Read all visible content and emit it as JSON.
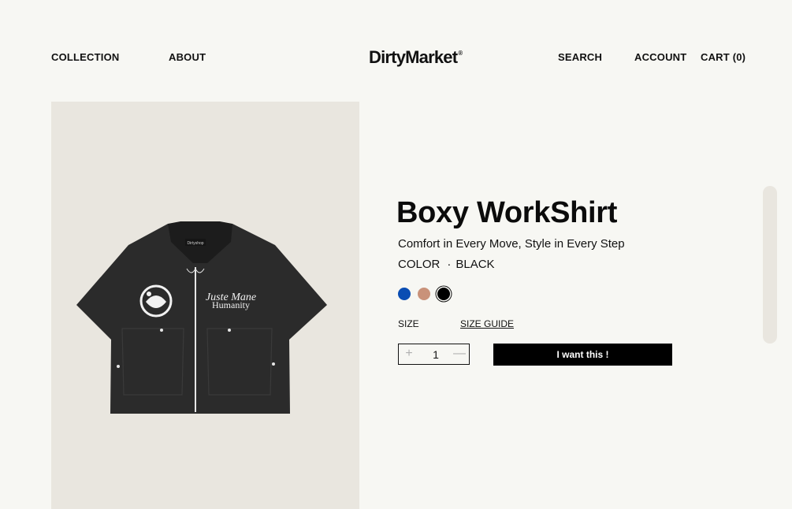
{
  "nav": {
    "collection": "COLLECTION",
    "about": "ABOUT",
    "logo": "DirtyMarket",
    "logo_mark": "®",
    "search": "SEARCH",
    "account": "ACCOUNT",
    "cart": "CART (0)"
  },
  "product": {
    "title": "Boxy WorkShirt",
    "subtitle": "Comfort in Every Move, Style in Every Step",
    "color_label": "COLOR",
    "color_separator": "·",
    "color_value": "BLACK",
    "swatches": [
      {
        "name": "blue",
        "color": "#0a4db3"
      },
      {
        "name": "tan",
        "color": "#c9927a"
      },
      {
        "name": "black",
        "color": "#000000",
        "selected": true
      }
    ],
    "size_label": "SIZE",
    "size_guide": "SIZE GUIDE",
    "quantity": "1",
    "plus_symbol": "+",
    "minus_symbol": "—",
    "cta_label": "I want this !"
  },
  "image": {
    "tag_text": "Dirtyshop",
    "print_line1": "Juste Mane",
    "print_line2": "Humanity",
    "background": "#e9e6df",
    "garment_color": "#2b2b2b"
  }
}
